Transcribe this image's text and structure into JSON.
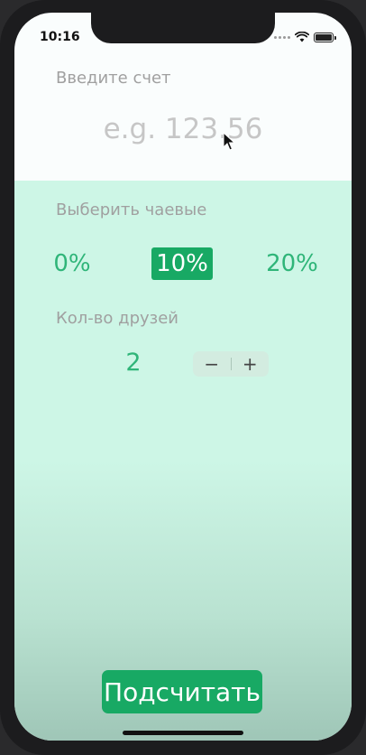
{
  "status_bar": {
    "time": "10:16",
    "icons": [
      "cellular-dots-icon",
      "wifi-icon",
      "battery-icon"
    ]
  },
  "bill": {
    "label": "Введите счет",
    "placeholder": "e.g. 123.56",
    "value": ""
  },
  "tip": {
    "label": "Выберить чаевые",
    "options": [
      "0%",
      "10%",
      "20%"
    ],
    "selected": "10%"
  },
  "friends": {
    "label": "Кол-во друзей",
    "count": "2",
    "decrement_label": "−",
    "increment_label": "+"
  },
  "calculate_button": {
    "label": "Подсчитать"
  },
  "colors": {
    "accent": "#18a964",
    "accent_text": "#2fb579",
    "label_gray": "#a0a0a0",
    "tip_background": "#cdf6e6"
  }
}
